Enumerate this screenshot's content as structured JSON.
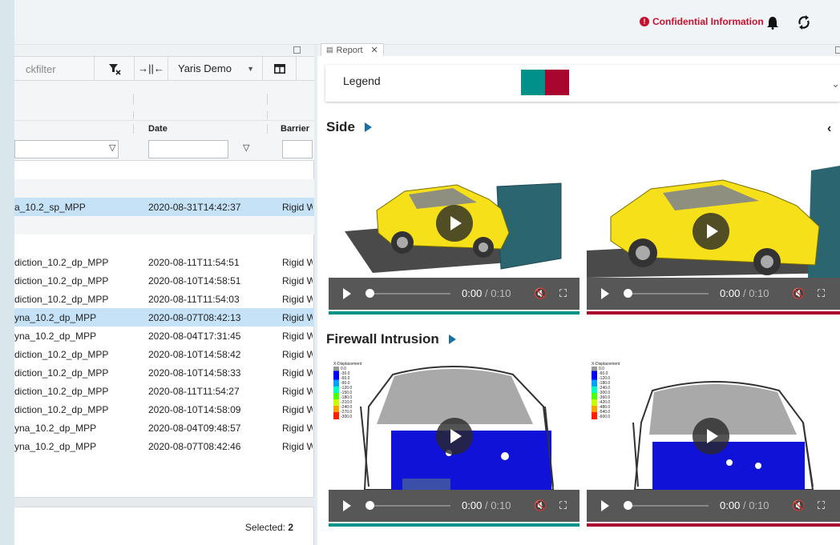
{
  "header": {
    "confidential_label": "Confidential Information",
    "icons": [
      "alert-icon",
      "bell-icon",
      "refresh-icon",
      "hamburger-menu-icon"
    ]
  },
  "left_panel": {
    "toolbar": {
      "quickfilter_placeholder": "ckfilter",
      "project_select": "Yaris Demo"
    },
    "columns": {
      "date": "Date",
      "barrier": "Barrier"
    },
    "rows": [
      {
        "name": "",
        "date": "",
        "barrier": ""
      },
      {
        "name": "",
        "date": "",
        "barrier": ""
      },
      {
        "name": "a_10.2_sp_MPP",
        "date": "2020-08-31T14:42:37",
        "barrier": "Rigid W"
      },
      {
        "name": "",
        "date": "",
        "barrier": ""
      },
      {
        "name": "",
        "date": "",
        "barrier": ""
      },
      {
        "name": "diction_10.2_dp_MPP",
        "date": "2020-08-11T11:54:51",
        "barrier": "Rigid W"
      },
      {
        "name": "diction_10.2_dp_MPP",
        "date": "2020-08-10T14:58:51",
        "barrier": "Rigid W"
      },
      {
        "name": "diction_10.2_dp_MPP",
        "date": "2020-08-11T11:54:03",
        "barrier": "Rigid W"
      },
      {
        "name": "yna_10.2_dp_MPP",
        "date": "2020-08-07T08:42:13",
        "barrier": "Rigid W"
      },
      {
        "name": "yna_10.2_dp_MPP",
        "date": "2020-08-04T17:31:45",
        "barrier": "Rigid W"
      },
      {
        "name": "diction_10.2_dp_MPP",
        "date": "2020-08-10T14:58:42",
        "barrier": "Rigid W"
      },
      {
        "name": "diction_10.2_dp_MPP",
        "date": "2020-08-10T14:58:33",
        "barrier": "Rigid W"
      },
      {
        "name": "diction_10.2_dp_MPP",
        "date": "2020-08-11T11:54:27",
        "barrier": "Rigid W"
      },
      {
        "name": "diction_10.2_dp_MPP",
        "date": "2020-08-10T14:58:09",
        "barrier": "Rigid W"
      },
      {
        "name": "yna_10.2_dp_MPP",
        "date": "2020-08-04T09:48:57",
        "barrier": "Rigid W"
      },
      {
        "name": "yna_10.2_dp_MPP",
        "date": "2020-08-07T08:42:46",
        "barrier": "Rigid W"
      }
    ],
    "selected_label": "Selected:",
    "selected_count": "2"
  },
  "right_panel": {
    "tab_label": "Report",
    "legend_label": "Legend",
    "colors": {
      "teal": "#00928a",
      "crimson": "#a8062f"
    },
    "sections": [
      {
        "title": "Side"
      },
      {
        "title": "Firewall Intrusion"
      }
    ],
    "video": {
      "current": "0:00",
      "separator": "/",
      "total": "0:10"
    },
    "fringe_title": "X-Displacement",
    "fringe_values_left": [
      "0.0",
      "-30.0",
      "-60.0",
      "-90.0",
      "-120.0",
      "-150.0",
      "-180.0",
      "-210.0",
      "-240.0",
      "-270.0",
      "-300.0"
    ],
    "fringe_values_right": [
      "0.0",
      "-60.0",
      "-120.0",
      "-180.0",
      "-240.0",
      "-300.0",
      "-360.0",
      "-420.0",
      "-480.0",
      "-540.0",
      "-600.0"
    ]
  }
}
